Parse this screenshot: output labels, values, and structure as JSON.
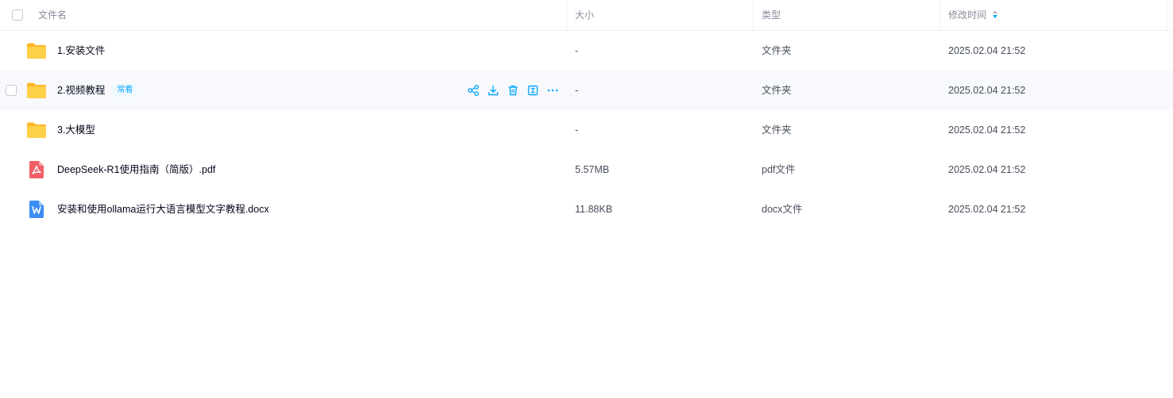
{
  "header": {
    "name": "文件名",
    "size": "大小",
    "type": "类型",
    "modified": "修改时间"
  },
  "colors": {
    "accent": "#06a7ff",
    "folder": "#ffc53d",
    "pdf": "#f35e67",
    "docx": "#3a8ef6"
  },
  "files": [
    {
      "icon": "folder-icon",
      "name": "1.安装文件",
      "tag": "",
      "size": "-",
      "type": "文件夹",
      "modified": "2025.02.04 21:52"
    },
    {
      "icon": "folder-icon",
      "name": "2.视频教程",
      "tag": "常看",
      "size": "-",
      "type": "文件夹",
      "modified": "2025.02.04 21:52"
    },
    {
      "icon": "folder-icon",
      "name": "3.大模型",
      "tag": "",
      "size": "-",
      "type": "文件夹",
      "modified": "2025.02.04 21:52"
    },
    {
      "icon": "pdf-file-icon",
      "name": "DeepSeek-R1使用指南（简版）.pdf",
      "tag": "",
      "size": "5.57MB",
      "type": "pdf文件",
      "modified": "2025.02.04 21:52"
    },
    {
      "icon": "docx-file-icon",
      "name": "安装和使用ollama运行大语言模型文字教程.docx",
      "tag": "",
      "size": "11.88KB",
      "type": "docx文件",
      "modified": "2025.02.04 21:52"
    }
  ],
  "row_actions": [
    "share-icon",
    "download-icon",
    "delete-icon",
    "rename-icon",
    "more-icon"
  ]
}
